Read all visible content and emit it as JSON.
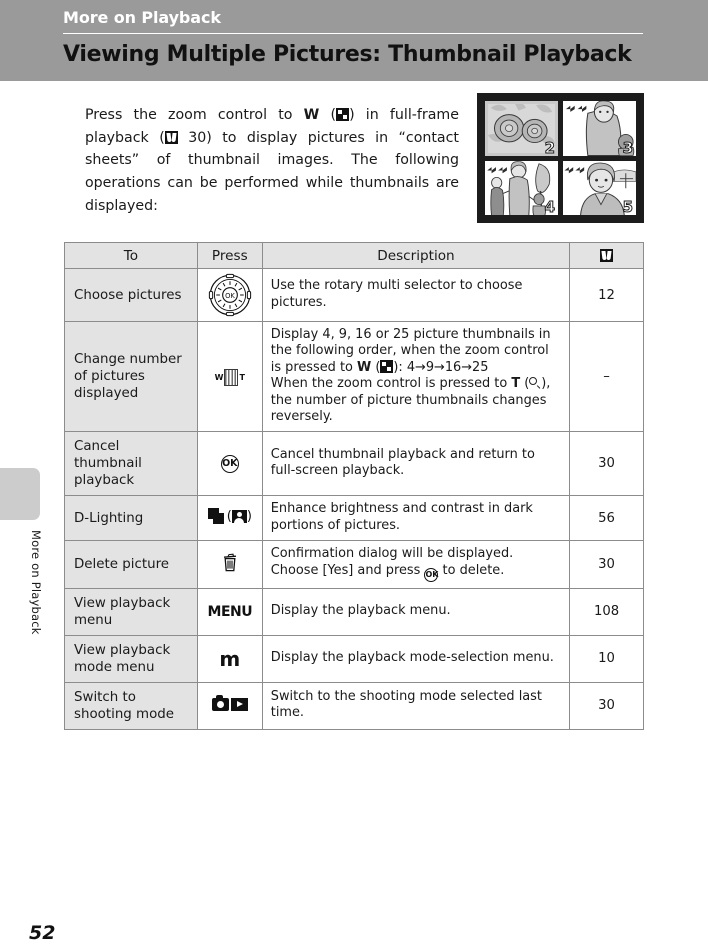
{
  "header": {
    "chapter": "More on Playback",
    "title": "Viewing Multiple Pictures: Thumbnail Playback"
  },
  "side_tab": {
    "label": "More on Playback"
  },
  "intro": {
    "seg1": "Press the zoom control to ",
    "w_label": "W",
    "seg2": " (",
    "seg3": ") in full-frame playback (",
    "page_ref_1": " 30) to display pictures in “contact sheets” of thumbnail images. The following operations can be performed while thumbnails are displayed:"
  },
  "figure": {
    "name": "thumbnail-playback-screen",
    "cells": [
      {
        "num": "2",
        "scene": "flowers",
        "selected": true
      },
      {
        "num": "3",
        "scene": "woman-and-child",
        "selected": false
      },
      {
        "num": "4",
        "scene": "family-outdoors",
        "selected": false
      },
      {
        "num": "5",
        "scene": "portrait-landscape",
        "selected": false
      }
    ]
  },
  "table": {
    "headers": {
      "to": "To",
      "press": "Press",
      "description": "Description",
      "reference": "page-reference-icon"
    },
    "rows": [
      {
        "to": "Choose pictures",
        "press_icon": "rotary-multi-selector",
        "press_label": "OK",
        "description": "Use the rotary multi selector to choose pictures.",
        "reference": "12"
      },
      {
        "to": "Change number of pictures displayed",
        "press_icon": "zoom-control",
        "press_label_w": "W",
        "press_label_t": "T",
        "desc_line1": "Display 4, 9, 16 or 25 picture thumbnails in the following order, when the zoom control is pressed to ",
        "desc_w": "W",
        "desc_line1b": "): 4→9→16→25",
        "desc_line2a": "When the zoom control is pressed to ",
        "desc_t": "T",
        "desc_line2b": "), the number of picture thumbnails changes reversely.",
        "reference": "–"
      },
      {
        "to": "Cancel thumbnail playback",
        "press_icon": "ok-button",
        "press_label": "OK",
        "description": "Cancel thumbnail playback and return to full-screen playback.",
        "reference": "30"
      },
      {
        "to": "D-Lighting",
        "press_icon": "d-lighting-button",
        "description": "Enhance brightness and contrast in dark portions of pictures.",
        "reference": "56"
      },
      {
        "to": "Delete picture",
        "press_icon": "trash-button",
        "desc_a": "Confirmation dialog will be displayed. Choose [Yes] and press ",
        "desc_b": " to delete.",
        "reference": "30"
      },
      {
        "to": "View playback menu",
        "press_icon": "menu-button",
        "press_label": "MENU",
        "description": "Display the playback menu.",
        "reference": "108"
      },
      {
        "to": "View playback mode menu",
        "press_icon": "mode-button",
        "press_label": "m",
        "description": "Display the playback mode-selection menu.",
        "reference": "10"
      },
      {
        "to": "Switch to shooting mode",
        "press_icon": "camera-playback-button",
        "description": "Switch to the shooting mode selected last time.",
        "reference": "30"
      }
    ]
  },
  "footer": {
    "page_number": "52"
  },
  "colors": {
    "header_band": "#9a9a9a",
    "table_header_bg": "#e3e3e3",
    "table_border": "#8c8c8c",
    "side_tab": "#cccccc"
  }
}
